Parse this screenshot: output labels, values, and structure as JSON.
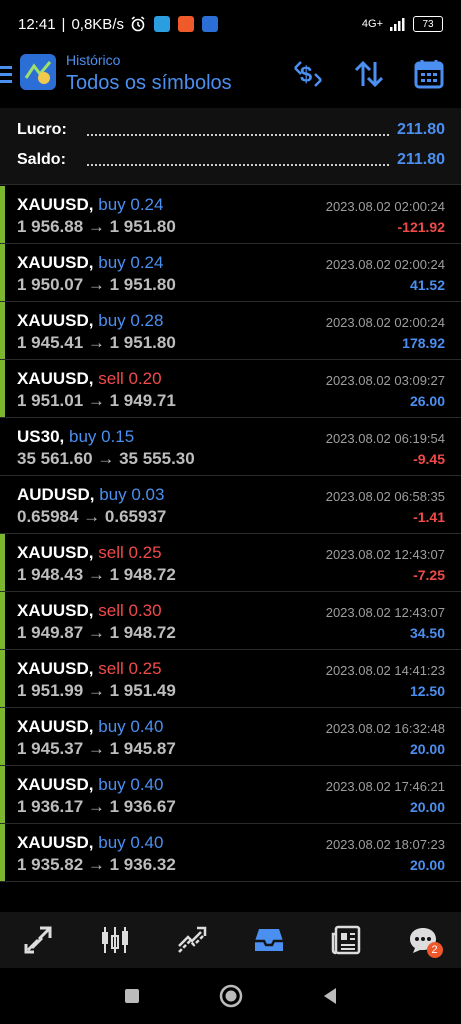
{
  "status_bar": {
    "time": "12:41",
    "speed": "0,8KB/s",
    "network": "4G+",
    "battery": "73"
  },
  "header": {
    "subtitle": "Histórico",
    "title": "Todos os símbolos"
  },
  "summary": {
    "profit_label": "Lucro:",
    "profit_value": "211.80",
    "balance_label": "Saldo:",
    "balance_value": "211.80"
  },
  "colors": {
    "accent": "#4b8ff0",
    "buy": "#4b8ff0",
    "sell": "#f04a4a",
    "positive": "#4b8ff0",
    "negative": "#f04a4a",
    "closed_bar": "#7cb82f"
  },
  "deals": [
    {
      "symbol": "XAUUSD,",
      "side": "buy 0.24",
      "type": "buy",
      "prices": "1 956.88 → 1 951.80",
      "time": "2023.08.02 02:00:24",
      "profit": "-121.92",
      "bar": true
    },
    {
      "symbol": "XAUUSD,",
      "side": "buy 0.24",
      "type": "buy",
      "prices": "1 950.07 → 1 951.80",
      "time": "2023.08.02 02:00:24",
      "profit": "41.52",
      "bar": true
    },
    {
      "symbol": "XAUUSD,",
      "side": "buy 0.28",
      "type": "buy",
      "prices": "1 945.41 → 1 951.80",
      "time": "2023.08.02 02:00:24",
      "profit": "178.92",
      "bar": true
    },
    {
      "symbol": "XAUUSD,",
      "side": "sell 0.20",
      "type": "sell",
      "prices": "1 951.01 → 1 949.71",
      "time": "2023.08.02 03:09:27",
      "profit": "26.00",
      "bar": true
    },
    {
      "symbol": "US30,",
      "side": "buy 0.15",
      "type": "buy",
      "prices": "35 561.60 → 35 555.30",
      "time": "2023.08.02 06:19:54",
      "profit": "-9.45",
      "bar": false
    },
    {
      "symbol": "AUDUSD,",
      "side": "buy 0.03",
      "type": "buy",
      "prices": "0.65984 → 0.65937",
      "time": "2023.08.02 06:58:35",
      "profit": "-1.41",
      "bar": false
    },
    {
      "symbol": "XAUUSD,",
      "side": "sell 0.25",
      "type": "sell",
      "prices": "1 948.43 → 1 948.72",
      "time": "2023.08.02 12:43:07",
      "profit": "-7.25",
      "bar": true
    },
    {
      "symbol": "XAUUSD,",
      "side": "sell 0.30",
      "type": "sell",
      "prices": "1 949.87 → 1 948.72",
      "time": "2023.08.02 12:43:07",
      "profit": "34.50",
      "bar": true
    },
    {
      "symbol": "XAUUSD,",
      "side": "sell 0.25",
      "type": "sell",
      "prices": "1 951.99 → 1 951.49",
      "time": "2023.08.02 14:41:23",
      "profit": "12.50",
      "bar": true
    },
    {
      "symbol": "XAUUSD,",
      "side": "buy 0.40",
      "type": "buy",
      "prices": "1 945.37 → 1 945.87",
      "time": "2023.08.02 16:32:48",
      "profit": "20.00",
      "bar": true
    },
    {
      "symbol": "XAUUSD,",
      "side": "buy 0.40",
      "type": "buy",
      "prices": "1 936.17 → 1 936.67",
      "time": "2023.08.02 17:46:21",
      "profit": "20.00",
      "bar": true
    },
    {
      "symbol": "XAUUSD,",
      "side": "buy 0.40",
      "type": "buy",
      "prices": "1 935.82 → 1 936.32",
      "time": "2023.08.02 18:07:23",
      "profit": "20.00",
      "bar": true
    }
  ],
  "tabbar": {
    "items": [
      {
        "icon": "quotes-icon",
        "active": false
      },
      {
        "icon": "chart-candles-icon",
        "active": false
      },
      {
        "icon": "trade-icon",
        "active": false
      },
      {
        "icon": "history-inbox-icon",
        "active": true
      },
      {
        "icon": "news-icon",
        "active": false
      },
      {
        "icon": "messages-icon",
        "active": false
      }
    ],
    "messages_badge": "2"
  }
}
